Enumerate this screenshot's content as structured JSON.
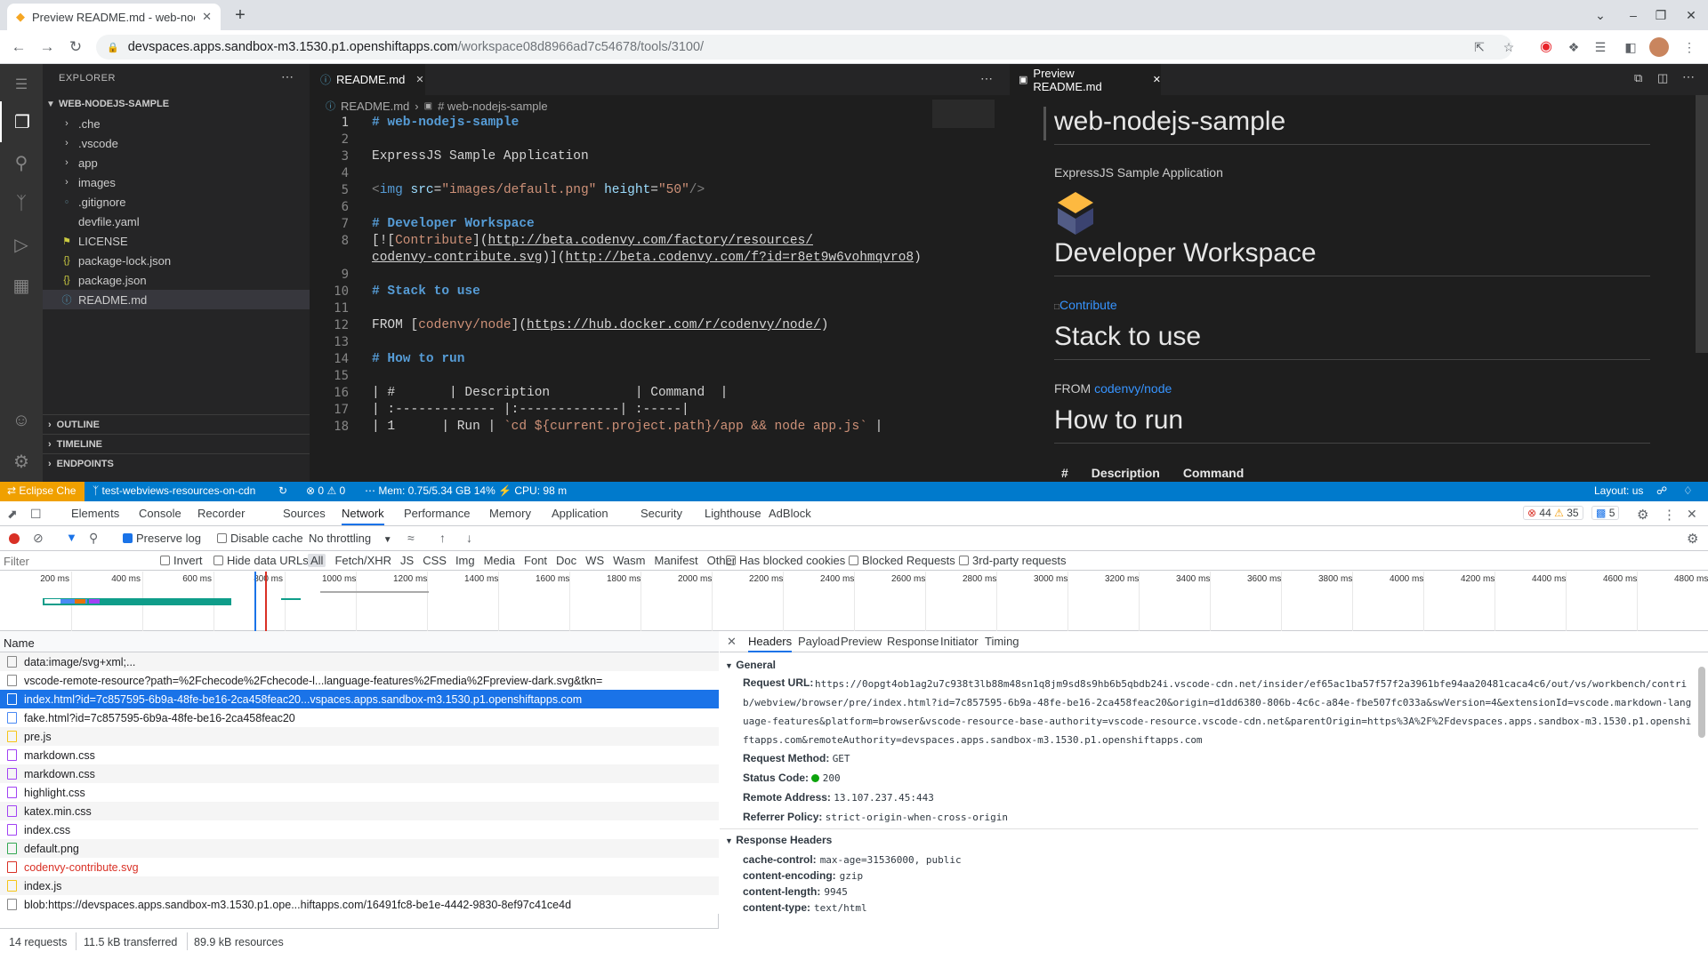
{
  "browser": {
    "tab_title": "Preview README.md - web-nodejs-sample",
    "url_host": "devspaces.apps.sandbox-m3.1530.p1.openshiftapps.com",
    "url_path": "/workspace08d8966ad7c54678/tools/3100/"
  },
  "ide": {
    "explorer_title": "EXPLORER",
    "root_folder": "WEB-NODEJS-SAMPLE",
    "files": [
      {
        "name": ".che",
        "kind": "folder"
      },
      {
        "name": ".vscode",
        "kind": "folder"
      },
      {
        "name": "app",
        "kind": "folder"
      },
      {
        "name": "images",
        "kind": "folder"
      },
      {
        "name": ".gitignore",
        "kind": "file"
      },
      {
        "name": "devfile.yaml",
        "kind": "file"
      },
      {
        "name": "LICENSE",
        "kind": "file"
      },
      {
        "name": "package-lock.json",
        "kind": "file"
      },
      {
        "name": "package.json",
        "kind": "file"
      },
      {
        "name": "README.md",
        "kind": "file"
      }
    ],
    "sections": [
      "OUTLINE",
      "TIMELINE",
      "ENDPOINTS"
    ],
    "editor_tab": "README.md",
    "breadcrumb_file": "README.md",
    "breadcrumb_symbol": "# web-nodejs-sample",
    "preview_tab": "Preview README.md",
    "preview": {
      "h1": "web-nodejs-sample",
      "subtitle": "ExpressJS Sample Application",
      "h_workspace": "Developer Workspace",
      "contribute": "Contribute",
      "h_stack": "Stack to use",
      "from_label": "FROM",
      "from_link": "codenvy/node",
      "h_run": "How to run",
      "table_cols": [
        "#",
        "Description",
        "Command"
      ]
    }
  },
  "statusbar": {
    "remote": "Eclipse Che",
    "branch": "test-webviews-resources-on-cdn",
    "problems": "0",
    "warnings": "0",
    "mem": "Mem: 0.75/5.34 GB 14%",
    "cpu": "CPU: 98 m",
    "layout": "Layout: us"
  },
  "devtools": {
    "tabs": [
      "Elements",
      "Console",
      "Recorder",
      "Sources",
      "Network",
      "Performance",
      "Memory",
      "Application",
      "Security",
      "Lighthouse",
      "AdBlock"
    ],
    "active_tab": "Network",
    "errors": "44",
    "warnings": "35",
    "messages": "5",
    "preserve_log": "Preserve log",
    "disable_cache": "Disable cache",
    "throttling": "No throttling",
    "filter_placeholder": "Filter",
    "invert": "Invert",
    "hide_data_urls": "Hide data URLs",
    "type_filters": [
      "All",
      "Fetch/XHR",
      "JS",
      "CSS",
      "Img",
      "Media",
      "Font",
      "Doc",
      "WS",
      "Wasm",
      "Manifest",
      "Other"
    ],
    "has_blocked_cookies": "Has blocked cookies",
    "blocked_requests": "Blocked Requests",
    "third_party": "3rd-party requests",
    "timeline_ticks": [
      "200 ms",
      "400 ms",
      "600 ms",
      "800 ms",
      "1000 ms",
      "1200 ms",
      "1400 ms",
      "1600 ms",
      "1800 ms",
      "2000 ms",
      "2200 ms",
      "2400 ms",
      "2600 ms",
      "2800 ms",
      "3000 ms",
      "3200 ms",
      "3400 ms",
      "3600 ms",
      "3800 ms",
      "4000 ms",
      "4200 ms",
      "4400 ms",
      "4600 ms",
      "4800 ms"
    ],
    "name_header": "Name",
    "requests": [
      {
        "name": "data:image/svg+xml;...",
        "color": "#888",
        "selected": false
      },
      {
        "name": "vscode-remote-resource?path=%2Fchecode%2Fchecode-l...language-features%2Fmedia%2Fpreview-dark.svg&tkn=",
        "color": "#888",
        "selected": false
      },
      {
        "name": "index.html?id=7c857595-6b9a-48fe-be16-2ca458feac20...vspaces.apps.sandbox-m3.1530.p1.openshiftapps.com",
        "color": "#4a8af4",
        "selected": true
      },
      {
        "name": "fake.html?id=7c857595-6b9a-48fe-be16-2ca458feac20",
        "color": "#4a8af4",
        "selected": false
      },
      {
        "name": "pre.js",
        "color": "#f5c518",
        "selected": false
      },
      {
        "name": "markdown.css",
        "color": "#a142f4",
        "selected": false
      },
      {
        "name": "markdown.css",
        "color": "#a142f4",
        "selected": false
      },
      {
        "name": "highlight.css",
        "color": "#a142f4",
        "selected": false
      },
      {
        "name": "katex.min.css",
        "color": "#a142f4",
        "selected": false
      },
      {
        "name": "index.css",
        "color": "#a142f4",
        "selected": false
      },
      {
        "name": "default.png",
        "color": "#34a853",
        "selected": false
      },
      {
        "name": "codenvy-contribute.svg",
        "color": "#d93025",
        "selected": false,
        "error": true
      },
      {
        "name": "index.js",
        "color": "#f5c518",
        "selected": false
      },
      {
        "name": "blob:https://devspaces.apps.sandbox-m3.1530.p1.ope...hiftapps.com/16491fc8-be1e-4442-9830-8ef97c41ce4d",
        "color": "#888",
        "selected": false
      }
    ],
    "summary": {
      "requests": "14 requests",
      "transferred": "11.5 kB transferred",
      "resources": "89.9 kB resources"
    },
    "detail_tabs": [
      "Headers",
      "Payload",
      "Preview",
      "Response",
      "Initiator",
      "Timing"
    ],
    "general_title": "General",
    "request_url_label": "Request URL:",
    "request_url_lines": [
      "https://0opgt4ob1ag2u7c938t3lb88m48sn1q8jm9sd8s9hb6b5qbdb24i.vscode-cdn.net/insider/ef65ac1ba57f57f2a3961bfe94aa20481caca4c6/out/vs/workbench/contri",
      "b/webview/browser/pre/index.html?id=7c857595-6b9a-48fe-be16-2ca458feac20&origin=d1dd6380-806b-4c6c-a84e-fbe507fc033a&swVersion=4&extensionId=vscode.markdown-lang",
      "uage-features&platform=browser&vscode-resource-base-authority=vscode-resource.vscode-cdn.net&parentOrigin=https%3A%2F%2Fdevspaces.apps.sandbox-m3.1530.p1.openshi",
      "ftapps.com&remoteAuthority=devspaces.apps.sandbox-m3.1530.p1.openshiftapps.com"
    ],
    "request_method_label": "Request Method:",
    "request_method": "GET",
    "status_code_label": "Status Code:",
    "status_code": "200",
    "remote_address_label": "Remote Address:",
    "remote_address": "13.107.237.45:443",
    "referrer_policy_label": "Referrer Policy:",
    "referrer_policy": "strict-origin-when-cross-origin",
    "response_headers_title": "Response Headers",
    "response_headers": [
      {
        "k": "cache-control:",
        "v": "max-age=31536000, public"
      },
      {
        "k": "content-encoding:",
        "v": "gzip"
      },
      {
        "k": "content-length:",
        "v": "9945"
      },
      {
        "k": "content-type:",
        "v": "text/html"
      }
    ]
  }
}
